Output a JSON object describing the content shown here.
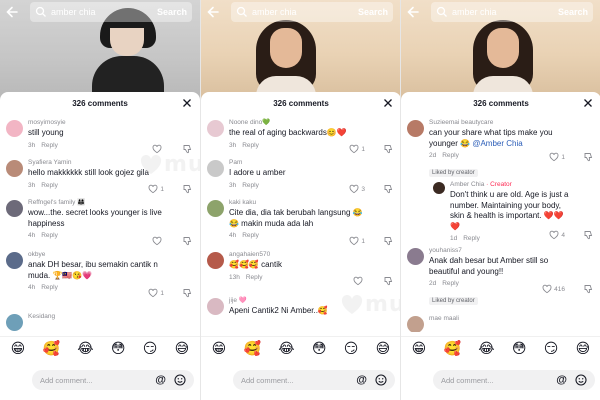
{
  "search": {
    "query": "amber chia",
    "button_label": "Search"
  },
  "panels": [
    {
      "sheet_title": "326 comments",
      "comments": [
        {
          "user": "mosyimosyie",
          "text": "still young",
          "time": "3h",
          "reply": "Reply",
          "likes": "",
          "avatar_color": "#f2b5c4"
        },
        {
          "user": "Syafiera Yamin",
          "text": "hello makkkkkk still look gojez gila",
          "time": "3h",
          "reply": "Reply",
          "likes": "1",
          "avatar_color": "#b98b78"
        },
        {
          "user": "Reffngel's family 👨‍👩‍👧",
          "text": "wow...the. secret looks younger is live happiness",
          "time": "4h",
          "reply": "Reply",
          "likes": "",
          "avatar_color": "#6d6a79"
        },
        {
          "user": "okbye",
          "text": "anak DH besar, ibu semakin cantik n muda. 🏆🇲🇾😘💗",
          "time": "4h",
          "reply": "Reply",
          "likes": "1",
          "avatar_color": "#5b6b8a"
        },
        {
          "user": "Kesidang",
          "text": "",
          "time": "",
          "reply": "",
          "likes": "",
          "avatar_color": "#6e9fb8"
        }
      ]
    },
    {
      "sheet_title": "326 comments",
      "comments": [
        {
          "user": "Noone dino💚",
          "text": "the real of aging backwards😊❤️",
          "time": "3h",
          "reply": "Reply",
          "likes": "1",
          "avatar_color": "#e7c9d2"
        },
        {
          "user": "Pam",
          "text": "I adore u amber",
          "time": "3h",
          "reply": "Reply",
          "likes": "3",
          "avatar_color": "#c9c9c9"
        },
        {
          "user": "kaki kaku",
          "text": "Cite dia, dia tak berubah langsung 😂😂 makin muda ada lah",
          "time": "4h",
          "reply": "Reply",
          "likes": "1",
          "avatar_color": "#8da36b"
        },
        {
          "user": "angahaien570",
          "text": "🥰🥰🥰 cantik",
          "time": "13h",
          "reply": "Reply",
          "likes": "",
          "avatar_color": "#b55a4a"
        },
        {
          "user": "jije 🩷",
          "text": "Apeni Cantik2 Ni Amber..🥰",
          "time": "",
          "reply": "",
          "likes": "",
          "avatar_color": "#d9b9c2"
        }
      ]
    },
    {
      "sheet_title": "326 comments",
      "comments": [
        {
          "user": "Suzieemai beautycare",
          "text": "can your share what tips make you younger 😂",
          "mention": "@Amber Chia",
          "time": "2d",
          "reply": "Reply",
          "likes": "1",
          "liked_by": "Liked by creator",
          "avatar_color": "#b77a66"
        },
        {
          "user": "Amber Chia",
          "creator_tag": "· Creator",
          "text": "Don't think u are old. Age is just a number. Maintaining your body, skin & health is important. ❤️❤️❤️",
          "time": "1d",
          "reply": "Reply",
          "likes": "4",
          "avatar_color": "#3b2a22"
        },
        {
          "user": "youhaniss7",
          "text": "Anak dah besar but Amber still so beautiful and young!!",
          "time": "2d",
          "reply": "Reply",
          "likes": "416",
          "liked_by": "Liked by creator",
          "avatar_color": "#8a7b8f"
        },
        {
          "user": "mae maali",
          "text": "",
          "time": "",
          "reply": "",
          "likes": "",
          "avatar_color": "#c2a08e"
        }
      ]
    }
  ],
  "emojis": [
    "😁",
    "🥰",
    "😂",
    "😳",
    "😏",
    "😅"
  ],
  "comment_input": {
    "placeholder": "Add comment...",
    "at_label": "@"
  },
  "watermark": "muru",
  "colors": {
    "creator": "#fe2c55",
    "mention": "#2b5db8",
    "heart": "#e0102f",
    "like_icon": "#8a8b91"
  }
}
